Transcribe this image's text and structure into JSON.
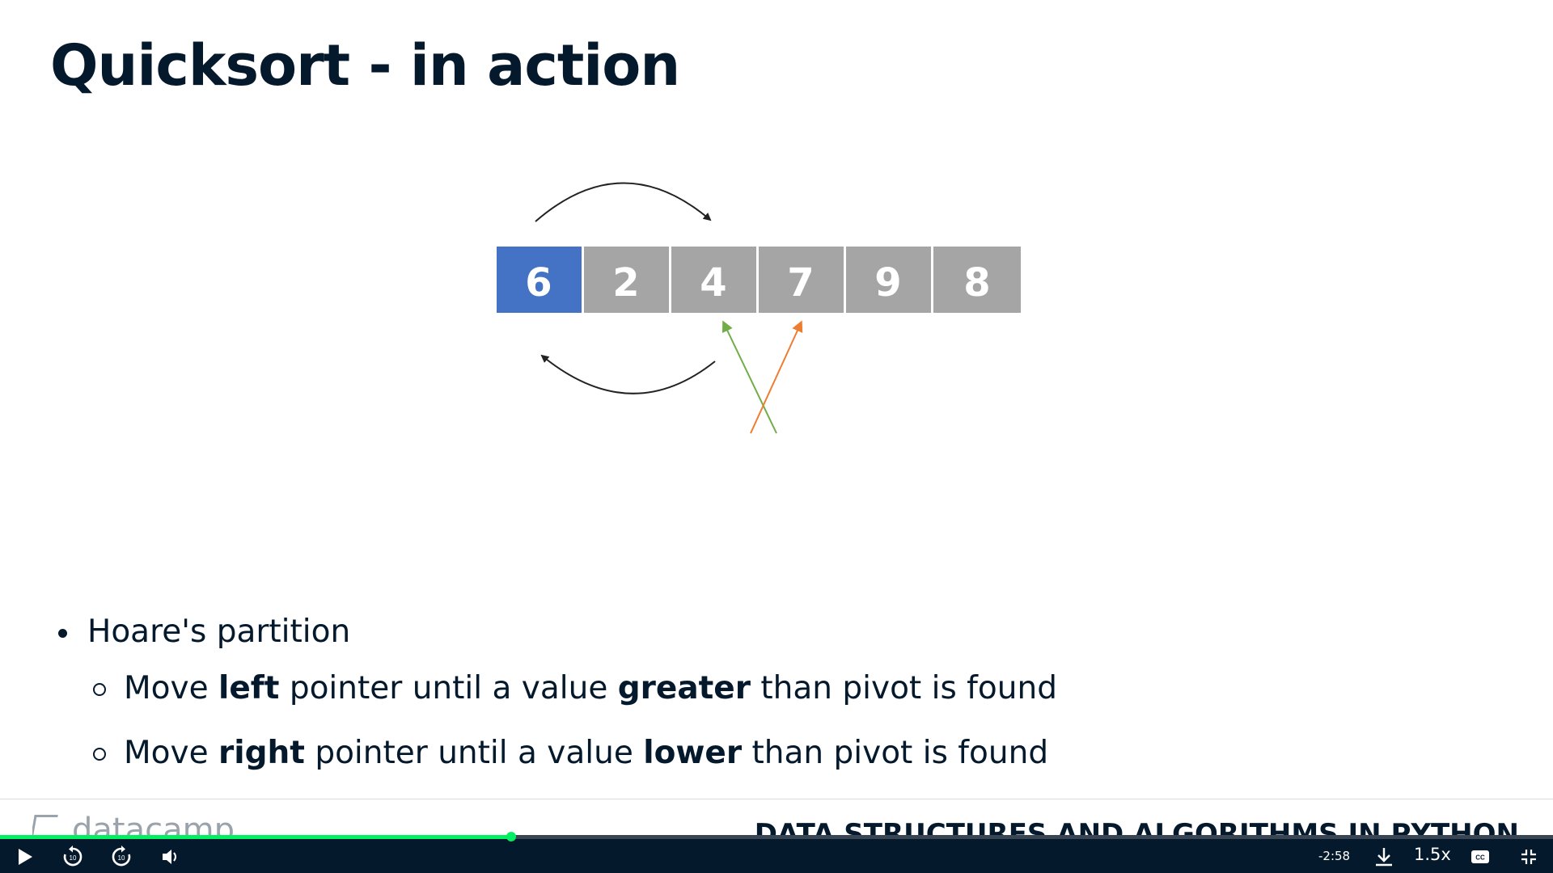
{
  "slide": {
    "title": "Quicksort - in action",
    "array": {
      "cells": [
        "6",
        "2",
        "4",
        "7",
        "9",
        "8"
      ],
      "pivot_index": 0,
      "colors": {
        "pivot": "#4472c4",
        "cell": "#a5a5a5",
        "left_pointer": "#70ad47",
        "right_pointer": "#ed7d31",
        "swap_arrow": "#222222"
      }
    },
    "bullets": {
      "main": "Hoare's partition",
      "sub1": {
        "p1": "Move ",
        "b1": "left",
        "p2": " pointer until a value ",
        "b2": "greater",
        "p3": " than pivot is found"
      },
      "sub2": {
        "p1": "Move ",
        "b1": "right",
        "p2": " pointer until a value ",
        "b2": "lower",
        "p3": " than pivot is found"
      }
    }
  },
  "footer": {
    "logo_text": "datacamp",
    "course_title": "DATA STRUCTURES AND ALGORITHMS IN PYTHON"
  },
  "player": {
    "progress_fraction": 0.329,
    "time_remaining": "-2:58",
    "speed": "1.5x",
    "colors": {
      "bar": "#05192d",
      "progress": "#03ef62"
    },
    "icons": [
      "play-icon",
      "rewind-10-icon",
      "forward-10-icon",
      "volume-icon",
      "download-icon",
      "captions-icon",
      "exit-fullscreen-icon"
    ]
  }
}
